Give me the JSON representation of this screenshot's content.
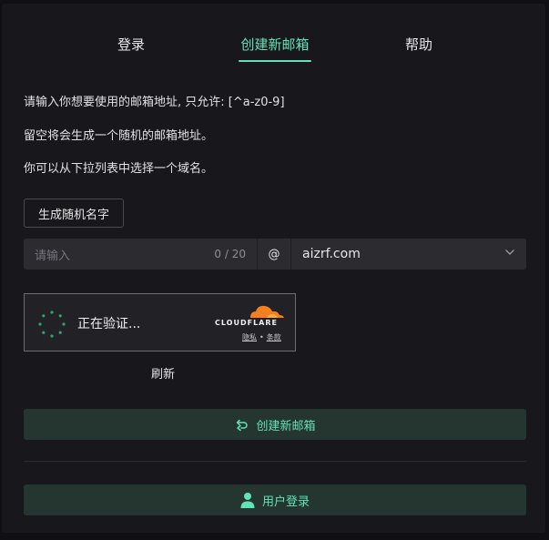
{
  "tabs": [
    {
      "label": "登录",
      "active": false
    },
    {
      "label": "创建新邮箱",
      "active": true
    },
    {
      "label": "帮助",
      "active": false
    }
  ],
  "instructions": [
    "请输入你想要使用的邮箱地址, 只允许: [^a-z0-9]",
    "留空将会生成一个随机的邮箱地址。",
    "你可以从下拉列表中选择一个域名。"
  ],
  "random_name_button": "生成随机名字",
  "address_input": {
    "placeholder": "请输入",
    "counter": "0 / 20",
    "at_symbol": "@",
    "domain_selected": "aizrf.com"
  },
  "captcha": {
    "status": "正在验证...",
    "brand": "CLOUDFLARE",
    "privacy_link": "隐私",
    "separator": "•",
    "terms_link": "条款",
    "refresh": "刷新"
  },
  "create_button": "创建新邮箱",
  "user_login_button": "用户登录",
  "colors": {
    "accent": "#63e2b7",
    "primary_button_bg": "#24362f",
    "panel_bg": "#18181c",
    "cloudflare_orange": "#f38020"
  },
  "icons": {
    "spinner": "loading-spinner-icon",
    "dropdown": "chevron-down-icon",
    "create": "swap-arrow-icon",
    "user": "user-icon",
    "cloudflare": "cloudflare-cloud-icon"
  }
}
